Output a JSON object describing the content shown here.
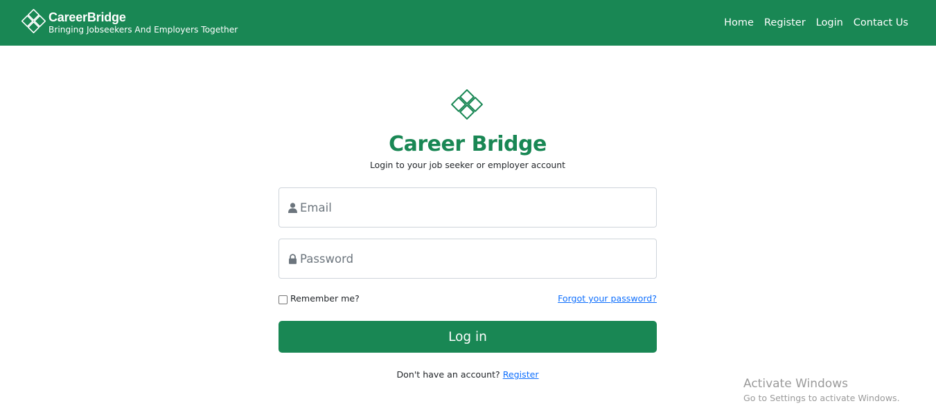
{
  "header": {
    "brand_name": "CareerBridge",
    "brand_tagline": "Bringing Jobseekers And Employers Together",
    "nav": [
      "Home",
      "Register",
      "Login",
      "Contact Us"
    ]
  },
  "login": {
    "title": "Career Bridge",
    "subtitle": "Login to your job seeker or employer account",
    "email_placeholder": "Email",
    "password_placeholder": "Password",
    "remember_label": "Remember me?",
    "forgot_label": "Forgot your password?",
    "submit_label": "Log in",
    "no_account_text": "Don't have an account?",
    "register_label": "Register"
  },
  "watermark": {
    "title": "Activate Windows",
    "subtitle": "Go to Settings to activate Windows."
  },
  "icons": {
    "logo": "diamond-lattice-logo",
    "email": "user-icon",
    "password": "lock-icon"
  },
  "colors": {
    "brand": "#198754",
    "link": "#0d6efd",
    "watermark": "#9a9a9a"
  }
}
